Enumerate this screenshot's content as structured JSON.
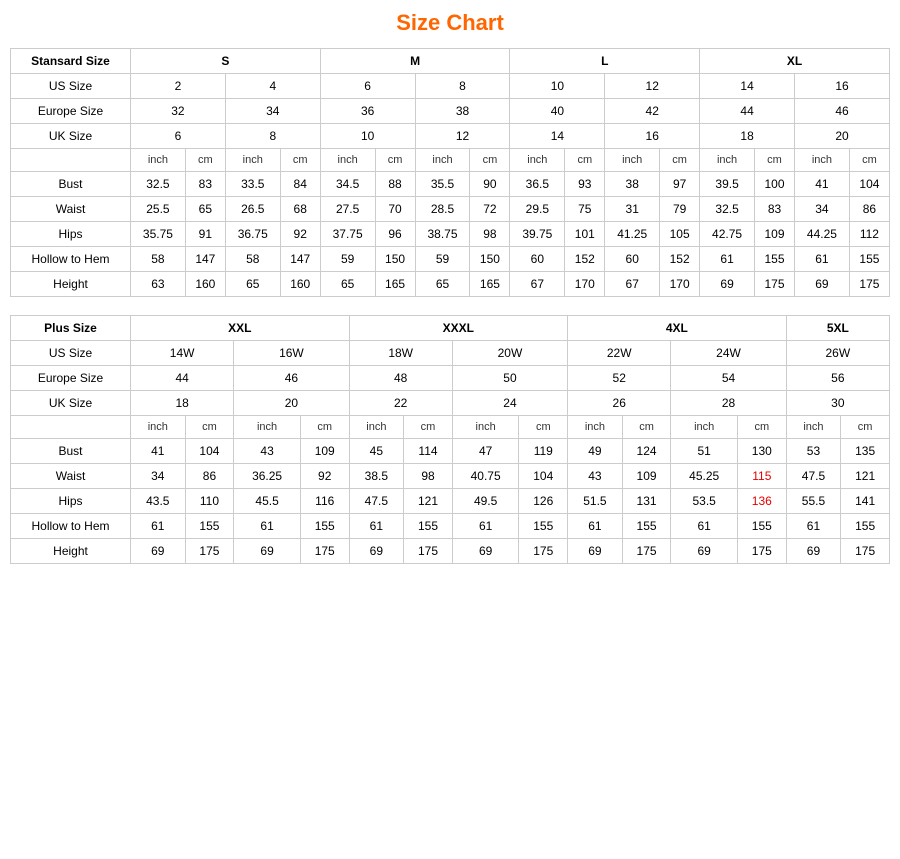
{
  "title": "Size Chart",
  "standard": {
    "label": "Stansard Size",
    "size_groups": [
      "S",
      "M",
      "L",
      "XL"
    ],
    "us_sizes": [
      "2",
      "4",
      "6",
      "8",
      "10",
      "12",
      "14",
      "16"
    ],
    "europe_sizes": [
      "32",
      "34",
      "36",
      "38",
      "40",
      "42",
      "44",
      "46"
    ],
    "uk_sizes": [
      "6",
      "8",
      "10",
      "12",
      "14",
      "16",
      "18",
      "20"
    ],
    "measurements": [
      {
        "label": "Bust",
        "values": [
          "32.5",
          "83",
          "33.5",
          "84",
          "34.5",
          "88",
          "35.5",
          "90",
          "36.5",
          "93",
          "38",
          "97",
          "39.5",
          "100",
          "41",
          "104"
        ]
      },
      {
        "label": "Waist",
        "values": [
          "25.5",
          "65",
          "26.5",
          "68",
          "27.5",
          "70",
          "28.5",
          "72",
          "29.5",
          "75",
          "31",
          "79",
          "32.5",
          "83",
          "34",
          "86"
        ]
      },
      {
        "label": "Hips",
        "values": [
          "35.75",
          "91",
          "36.75",
          "92",
          "37.75",
          "96",
          "38.75",
          "98",
          "39.75",
          "101",
          "41.25",
          "105",
          "42.75",
          "109",
          "44.25",
          "112"
        ]
      },
      {
        "label": "Hollow to Hem",
        "values": [
          "58",
          "147",
          "58",
          "147",
          "59",
          "150",
          "59",
          "150",
          "60",
          "152",
          "60",
          "152",
          "61",
          "155",
          "61",
          "155"
        ]
      },
      {
        "label": "Height",
        "values": [
          "63",
          "160",
          "65",
          "160",
          "65",
          "165",
          "65",
          "165",
          "67",
          "170",
          "67",
          "170",
          "69",
          "175",
          "69",
          "175"
        ]
      }
    ]
  },
  "plus": {
    "label": "Plus Size",
    "size_groups": [
      "XXL",
      "XXXL",
      "4XL",
      "5XL"
    ],
    "us_sizes": [
      "14W",
      "16W",
      "18W",
      "20W",
      "22W",
      "24W",
      "26W"
    ],
    "europe_sizes": [
      "44",
      "46",
      "48",
      "50",
      "52",
      "54",
      "56"
    ],
    "uk_sizes": [
      "18",
      "20",
      "22",
      "24",
      "26",
      "28",
      "30"
    ],
    "measurements": [
      {
        "label": "Bust",
        "values": [
          "41",
          "104",
          "43",
          "109",
          "45",
          "114",
          "47",
          "119",
          "49",
          "124",
          "51",
          "130",
          "53",
          "135"
        ]
      },
      {
        "label": "Waist",
        "values": [
          "34",
          "86",
          "36.25",
          "92",
          "38.5",
          "98",
          "40.75",
          "104",
          "43",
          "109",
          "45.25",
          "115",
          "47.5",
          "121"
        ]
      },
      {
        "label": "Hips",
        "values": [
          "43.5",
          "110",
          "45.5",
          "116",
          "47.5",
          "121",
          "49.5",
          "126",
          "51.5",
          "131",
          "53.5",
          "136",
          "55.5",
          "141"
        ]
      },
      {
        "label": "Hollow to Hem",
        "values": [
          "61",
          "155",
          "61",
          "155",
          "61",
          "155",
          "61",
          "155",
          "61",
          "155",
          "61",
          "155",
          "61",
          "155"
        ]
      },
      {
        "label": "Height",
        "values": [
          "69",
          "175",
          "69",
          "175",
          "69",
          "175",
          "69",
          "175",
          "69",
          "175",
          "69",
          "175",
          "69",
          "175"
        ]
      }
    ]
  }
}
